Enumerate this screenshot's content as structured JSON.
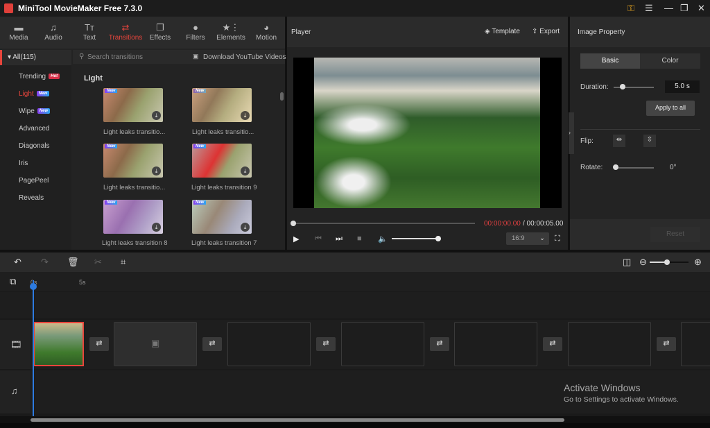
{
  "app": {
    "title": "MiniTool MovieMaker Free 7.3.0"
  },
  "window_controls": {
    "key": "⚿",
    "menu": "☰",
    "restore": "❐",
    "close": "✕"
  },
  "toolbar": [
    {
      "label": "Media",
      "icon": "▬"
    },
    {
      "label": "Audio",
      "icon": "♫"
    },
    {
      "label": "Text",
      "icon": "Tт"
    },
    {
      "label": "Transitions",
      "icon": "⇄",
      "active": true
    },
    {
      "label": "Effects",
      "icon": "❐"
    },
    {
      "label": "Filters",
      "icon": "●"
    },
    {
      "label": "Elements",
      "icon": "★⋮"
    },
    {
      "label": "Motion",
      "icon": "◕"
    }
  ],
  "categories": {
    "all": "All(115)",
    "items": [
      {
        "label": "Trending",
        "badge": "Hot"
      },
      {
        "label": "Light",
        "badge": "New",
        "active": true
      },
      {
        "label": "Wipe",
        "badge": "New"
      },
      {
        "label": "Advanced"
      },
      {
        "label": "Diagonals"
      },
      {
        "label": "Iris"
      },
      {
        "label": "PagePeel"
      },
      {
        "label": "Reveals"
      }
    ]
  },
  "search": {
    "placeholder": "Search transitions",
    "download": "Download YouTube Videos"
  },
  "section": "Light",
  "transitions": [
    {
      "label": "Light leaks transitio...",
      "badge": "New"
    },
    {
      "label": "Light leaks transitio...",
      "badge": "New"
    },
    {
      "label": "Light leaks transitio...",
      "badge": "New"
    },
    {
      "label": "Light leaks transition 9",
      "badge": "New"
    },
    {
      "label": "Light leaks transition 8",
      "badge": "New"
    },
    {
      "label": "Light leaks transition 7",
      "badge": "New"
    }
  ],
  "player": {
    "title": "Player",
    "template": "Template",
    "export": "Export",
    "current_time": "00:00:00.00",
    "total_time": "/ 00:00:05.00",
    "aspect": "16:9",
    "volume": 1.0,
    "progress": 0
  },
  "property": {
    "title": "Image Property",
    "tabs": [
      "Basic",
      "Color"
    ],
    "duration_label": "Duration:",
    "duration": "5.0 s",
    "apply_all": "Apply to all",
    "flip_label": "Flip:",
    "rotate_label": "Rotate:",
    "rotate": "0°",
    "reset": "Reset"
  },
  "timeline": {
    "ticks": [
      "0s",
      "5s"
    ]
  },
  "watermark": {
    "line1": "Activate Windows",
    "line2": "Go to Settings to activate Windows."
  },
  "colors": {
    "accent": "#e8453c",
    "playhead": "#2d7be0"
  }
}
